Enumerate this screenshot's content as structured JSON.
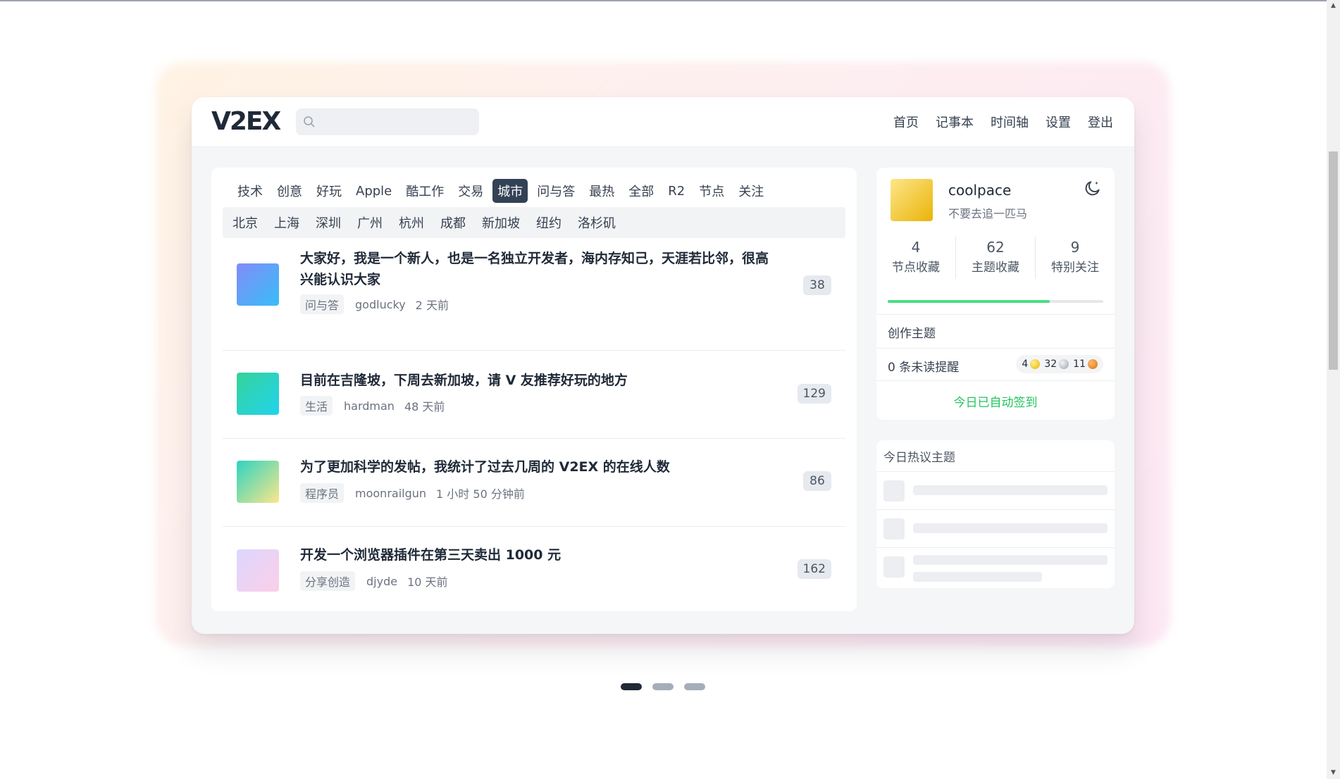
{
  "header": {
    "logo": "V2EX",
    "search_placeholder": "",
    "nav": [
      "首页",
      "记事本",
      "时间轴",
      "设置",
      "登出"
    ]
  },
  "tabs": {
    "items": [
      "技术",
      "创意",
      "好玩",
      "Apple",
      "酷工作",
      "交易",
      "城市",
      "问与答",
      "最热",
      "全部",
      "R2",
      "节点",
      "关注"
    ],
    "active": "城市"
  },
  "subtabs": [
    "北京",
    "上海",
    "深圳",
    "广州",
    "杭州",
    "成都",
    "新加坡",
    "纽约",
    "洛杉矶"
  ],
  "topics": [
    {
      "title": "大家好，我是一个新人，也是一名独立开发者，海内存知己，天涯若比邻，很高兴能认识大家",
      "node": "问与答",
      "author": "godlucky",
      "time": "2 天前",
      "replies": "38"
    },
    {
      "title": "目前在吉隆坡，下周去新加坡，请 V 友推荐好玩的地方",
      "node": "生活",
      "author": "hardman",
      "time": "48 天前",
      "replies": "129"
    },
    {
      "title": "为了更加科学的发帖，我统计了过去几周的 V2EX 的在线人数",
      "node": "程序员",
      "author": "moonrailgun",
      "time": "1 小时 50 分钟前",
      "replies": "86"
    },
    {
      "title": "开发一个浏览器插件在第三天卖出 1000 元",
      "node": "分享创造",
      "author": "djyde",
      "time": "10 天前",
      "replies": "162"
    }
  ],
  "user": {
    "name": "coolpace",
    "motto": "不要去追一匹马",
    "stats": [
      {
        "num": "4",
        "label": "节点收藏"
      },
      {
        "num": "62",
        "label": "主题收藏"
      },
      {
        "num": "9",
        "label": "特别关注"
      }
    ],
    "progress": 0.75,
    "create_topic": "创作主题",
    "unread": "0 条未读提醒",
    "balance": {
      "gold": "4",
      "silver": "32",
      "bronze": "11"
    },
    "signin": "今日已自动签到"
  },
  "hot": {
    "title": "今日热议主题"
  },
  "icons": {
    "search": "search-icon",
    "theme": "moon-icon"
  },
  "colors": {
    "active_tab": "#334155",
    "signin": "#22c55e",
    "progress": "#4ade80"
  }
}
